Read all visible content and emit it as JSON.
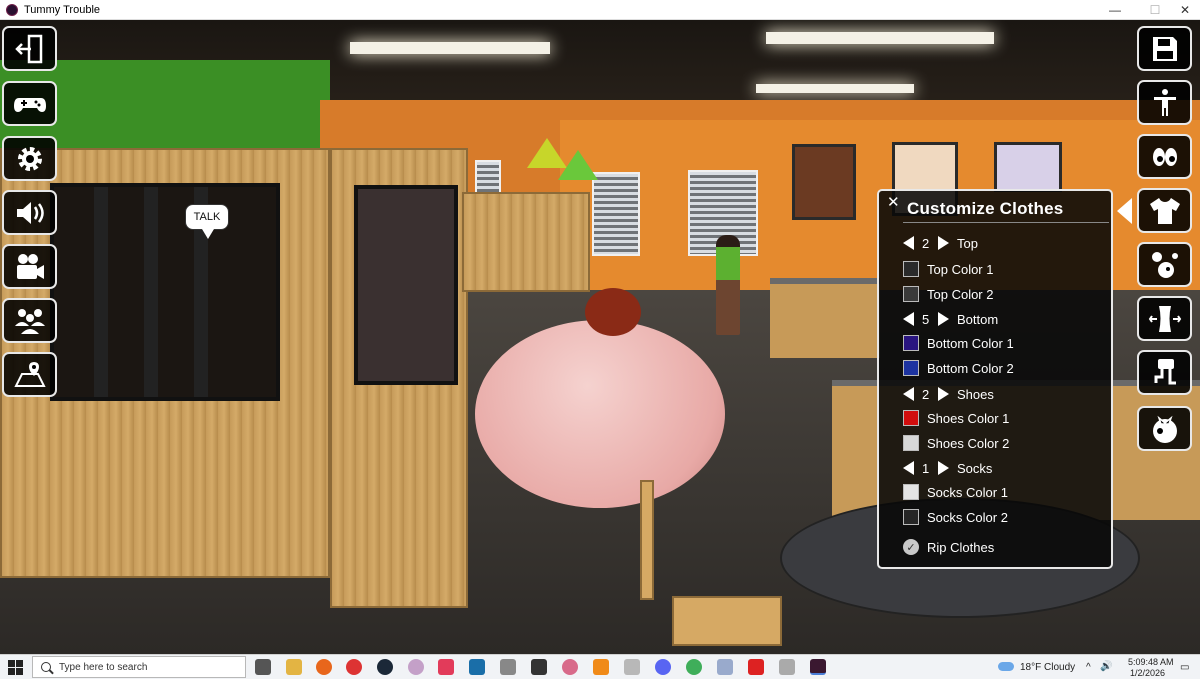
{
  "window": {
    "title": "Tummy Trouble"
  },
  "scene": {
    "talk_label": "TALK"
  },
  "left_menu": [
    {
      "name": "exit-icon"
    },
    {
      "name": "gamepad-icon"
    },
    {
      "name": "gear-icon"
    },
    {
      "name": "speaker-icon"
    },
    {
      "name": "camera-icon"
    },
    {
      "name": "group-icon"
    },
    {
      "name": "map-icon"
    }
  ],
  "right_menu": [
    {
      "name": "save-icon"
    },
    {
      "name": "body-pose-icon"
    },
    {
      "name": "eyes-icon"
    },
    {
      "name": "shirt-icon",
      "active": true
    },
    {
      "name": "bubbles-icon"
    },
    {
      "name": "waist-icon"
    },
    {
      "name": "pipe-icon"
    },
    {
      "name": "tomato-icon"
    }
  ],
  "panel": {
    "title": "Customize Clothes",
    "close_label": "✕",
    "rows": [
      {
        "kind": "selector",
        "value": "2",
        "label": "Top"
      },
      {
        "kind": "color",
        "color": "#2a2a2a",
        "label": "Top Color 1"
      },
      {
        "kind": "color",
        "color": "#3a3a3a",
        "label": "Top Color 2"
      },
      {
        "kind": "selector",
        "value": "5",
        "label": "Bottom"
      },
      {
        "kind": "color",
        "color": "#2a1580",
        "label": "Bottom Color 1"
      },
      {
        "kind": "color",
        "color": "#1d33a0",
        "label": "Bottom Color 2"
      },
      {
        "kind": "selector",
        "value": "2",
        "label": "Shoes"
      },
      {
        "kind": "color",
        "color": "#d10d0d",
        "label": "Shoes Color 1"
      },
      {
        "kind": "color",
        "color": "#d8d8d8",
        "label": "Shoes Color 2"
      },
      {
        "kind": "selector",
        "value": "1",
        "label": "Socks"
      },
      {
        "kind": "color",
        "color": "#e4e4e4",
        "label": "Socks Color 1"
      },
      {
        "kind": "color",
        "color": "#262626",
        "label": "Socks Color 2"
      },
      {
        "kind": "toggle",
        "label": "Rip Clothes",
        "checked": true
      }
    ]
  },
  "taskbar": {
    "search_placeholder": "Type here to search",
    "weather": "18°F  Cloudy",
    "time": "5:09:48 AM",
    "date": "1/2/2026"
  }
}
